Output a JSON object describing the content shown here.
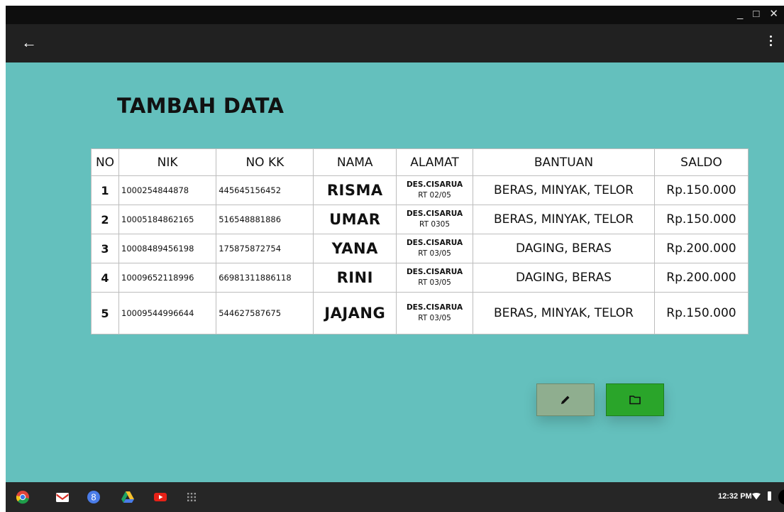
{
  "window": {
    "minimize_symbol": "_",
    "maximize_symbol": "□",
    "close_symbol": "✕"
  },
  "appbar": {
    "back_icon": "arrow-left-icon",
    "menu_icon": "more-vert-icon"
  },
  "page": {
    "title": "TAMBAH DATA"
  },
  "table": {
    "headers": [
      "NO",
      "NIK",
      "NO KK",
      "NAMA",
      "ALAMAT",
      "BANTUAN",
      "SALDO"
    ],
    "rows": [
      {
        "no": "1",
        "nik": "1000254844878",
        "no_kk": "445645156452",
        "nama": "RISMA",
        "alamat_line1": "DES.CISARUA",
        "alamat_line2": "RT 02/05",
        "bantuan": "BERAS, MINYAK, TELOR",
        "saldo": "Rp.150.000"
      },
      {
        "no": "2",
        "nik": "10005184862165",
        "no_kk": "516548881886",
        "nama": "UMAR",
        "alamat_line1": "DES.CISARUA",
        "alamat_line2": "RT 0305",
        "bantuan": "BERAS, MINYAK, TELOR",
        "saldo": "Rp.150.000"
      },
      {
        "no": "3",
        "nik": "10008489456198",
        "no_kk": "175875872754",
        "nama": "YANA",
        "alamat_line1": "DES.CISARUA",
        "alamat_line2": "RT 03/05",
        "bantuan": "DAGING, BERAS",
        "saldo": "Rp.200.000"
      },
      {
        "no": "4",
        "nik": "10009652118996",
        "no_kk": "66981311886118",
        "nama": "RINI",
        "alamat_line1": "DES.CISARUA",
        "alamat_line2": "RT 03/05",
        "bantuan": "DAGING, BERAS",
        "saldo": "Rp.200.000"
      },
      {
        "no": "5",
        "nik": "10009544996644",
        "no_kk": "544627587675",
        "nama": "JAJANG",
        "alamat_line1": "DES.CISARUA",
        "alamat_line2": "RT 03/05",
        "bantuan": "BERAS, MINYAK, TELOR",
        "saldo": "Rp.150.000"
      }
    ]
  },
  "actions": {
    "edit_icon": "pencil-icon",
    "folder_icon": "folder-icon"
  },
  "shelf": {
    "apps": [
      "chrome-icon",
      "gmail-icon",
      "google-search-icon",
      "google-drive-icon",
      "youtube-icon",
      "app-launcher-icon"
    ],
    "clock": "12:32 PM",
    "status_icons": [
      "wifi-icon",
      "battery-icon",
      "avatar"
    ]
  },
  "colors": {
    "content_bg": "#64c0bd",
    "appbar_bg": "#212121",
    "titlebar_bg": "#0e0e0e",
    "shelf_bg": "#262626",
    "edit_button": "#8fae8f",
    "folder_button": "#2aa52a"
  }
}
